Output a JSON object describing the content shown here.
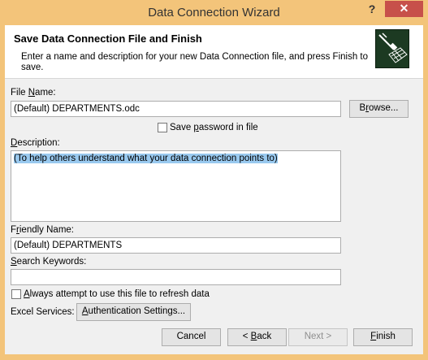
{
  "window": {
    "title": "Data Connection Wizard",
    "help_label": "?",
    "close_label": "✕"
  },
  "header": {
    "title": "Save Data Connection File and Finish",
    "description": "Enter a name and description for your new Data Connection file, and press Finish to save."
  },
  "file_name": {
    "label_pre": "File ",
    "label_mn": "N",
    "label_post": "ame:",
    "value": "(Default) DEPARTMENTS.odc",
    "browse_pre": "B",
    "browse_mn": "r",
    "browse_post": "owse..."
  },
  "save_password": {
    "pre": "Save ",
    "mn": "p",
    "post": "assword in file",
    "checked": false
  },
  "description": {
    "mn": "D",
    "post": "escription:",
    "value": "(To help others understand what your data connection points to)"
  },
  "friendly_name": {
    "pre": "F",
    "mn": "r",
    "post": "iendly Name:",
    "value": "(Default) DEPARTMENTS"
  },
  "search_keywords": {
    "pre": "",
    "mn": "S",
    "post": "earch Keywords:",
    "value": ""
  },
  "always_refresh": {
    "mn": "A",
    "post": "lways attempt to use this file to refresh data",
    "checked": false
  },
  "excel_services": {
    "label": "Excel Services:",
    "auth_mn": "A",
    "auth_post": "uthentication Settings..."
  },
  "footer": {
    "cancel": "Cancel",
    "back_pre": "< ",
    "back_mn": "B",
    "back_post": "ack",
    "next": "Next >",
    "finish_mn": "F",
    "finish_post": "inish"
  }
}
